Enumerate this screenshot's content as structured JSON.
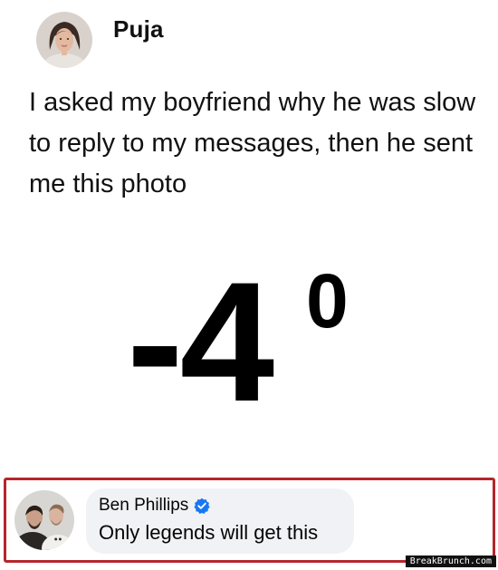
{
  "post": {
    "author": "Puja",
    "text": "I asked my boyfriend why he was slow to reply to my messages, then he sent me this photo",
    "image": {
      "value": "-4",
      "degree_mark": "0"
    }
  },
  "comment": {
    "author": "Ben Phillips",
    "text": "Only legends will get this",
    "verified": true,
    "highlight_color": "#b5262c"
  },
  "watermark": "BreakBrunch.com",
  "icons": {
    "verified": "verified-badge-icon"
  },
  "colors": {
    "verified_blue": "#1877f2",
    "bubble_bg": "#f0f2f5"
  }
}
